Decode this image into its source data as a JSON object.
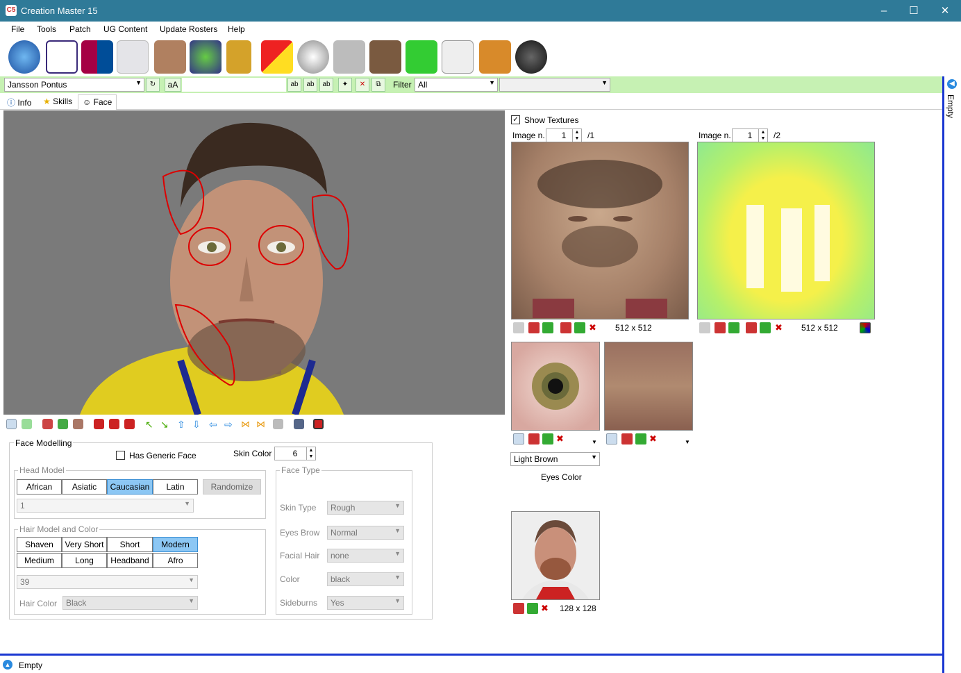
{
  "window": {
    "title": "Creation Master 15",
    "app_icon": "C5"
  },
  "menu": [
    "File",
    "Tools",
    "Patch",
    "UG Content",
    "Update Rosters",
    "Help"
  ],
  "toolbar_icons": [
    "globe-icon",
    "premier-league-icon",
    "fcb-crest-icon",
    "jersey-icon",
    "player-face-icon",
    "stadium-icon",
    "trophy-icon",
    "cards-icon",
    "ball-icon",
    "boots-icon",
    "manager-icon",
    "pitch-icon",
    "newspaper-icon",
    "gloves-icon",
    "headphones-icon"
  ],
  "filterbar": {
    "player": "Jansson Pontus",
    "case_btn": "aA",
    "filter_label": "Filter",
    "filter_value": "All",
    "second_value": ""
  },
  "tabs": [
    {
      "label": "Info"
    },
    {
      "label": "Skills"
    },
    {
      "label": "Face"
    }
  ],
  "face_modelling": {
    "title": "Face Modelling",
    "generic_face_label": "Has Generic Face",
    "skin_color_label": "Skin Color",
    "skin_color": "6",
    "head_model": {
      "title": "Head Model",
      "options": [
        "African",
        "Asiatic",
        "Caucasian",
        "Latin"
      ],
      "selected": "Caucasian",
      "randomize": "Randomize",
      "value": "1"
    },
    "hair": {
      "title": "Hair Model and Color",
      "options": [
        "Shaven",
        "Very Short",
        "Short",
        "Modern",
        "Medium",
        "Long",
        "Headband",
        "Afro"
      ],
      "selected": "Modern",
      "value": "39",
      "color_label": "Hair Color",
      "color": "Black"
    },
    "face_type": {
      "title": "Face Type",
      "rows": [
        {
          "label": "Skin Type",
          "value": "Rough"
        },
        {
          "label": "Eyes Brow",
          "value": "Normal"
        },
        {
          "label": "Facial Hair",
          "value": "none"
        },
        {
          "label": "Color",
          "value": "black"
        },
        {
          "label": "Sideburns",
          "value": "Yes"
        }
      ]
    }
  },
  "textures": {
    "show_label": "Show Textures",
    "image1": {
      "label": "Image n.",
      "value": "1",
      "total": "/1",
      "size": "512 x 512"
    },
    "image2": {
      "label": "Image n.",
      "value": "1",
      "total": "/2",
      "size": "512 x 512"
    },
    "eyes_color_value": "Light Brown",
    "eyes_color_label": "Eyes Color",
    "portrait_size": "128 x 128"
  },
  "rightbar": {
    "label": "Empty"
  },
  "status": {
    "label": "Empty"
  },
  "colors": {
    "titlebar": "#2f7a98",
    "filterbar": "#c6f1b3",
    "accent": "#1a37d1",
    "selected": "#8cc7f4"
  }
}
